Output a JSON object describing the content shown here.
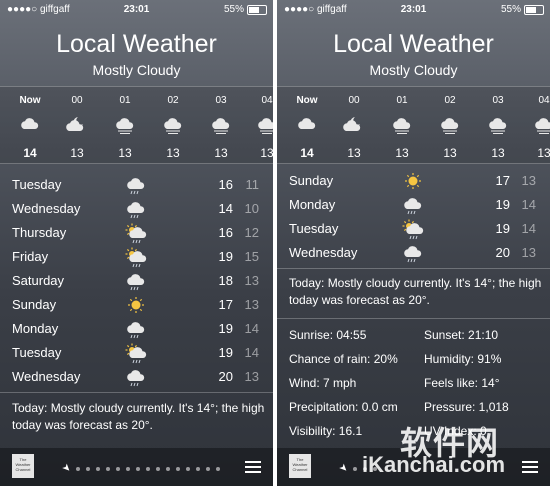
{
  "left": {
    "status": {
      "carrier": "●●●●○ giffgaff",
      "time": "23:01",
      "battery": "55%"
    },
    "title": "Local Weather",
    "subtitle": "Mostly Cloudy",
    "hourly": [
      {
        "label": "Now",
        "icon": "cloud-icon",
        "temp": "14"
      },
      {
        "label": "00",
        "icon": "partly-cloudy-night-icon",
        "temp": "13"
      },
      {
        "label": "01",
        "icon": "cloud-wind-icon",
        "temp": "13"
      },
      {
        "label": "02",
        "icon": "cloud-wind-icon",
        "temp": "13"
      },
      {
        "label": "03",
        "icon": "cloud-wind-icon",
        "temp": "13"
      },
      {
        "label": "04",
        "icon": "cloud-wind-icon",
        "temp": "13"
      }
    ],
    "daily": [
      {
        "day": "Tuesday",
        "icon": "cloud-rain-icon",
        "hi": "16",
        "lo": "11"
      },
      {
        "day": "Wednesday",
        "icon": "cloud-rain-icon",
        "hi": "14",
        "lo": "10"
      },
      {
        "day": "Thursday",
        "icon": "sun-cloud-rain-icon",
        "hi": "16",
        "lo": "12"
      },
      {
        "day": "Friday",
        "icon": "sun-cloud-rain-icon",
        "hi": "19",
        "lo": "15"
      },
      {
        "day": "Saturday",
        "icon": "cloud-rain-icon",
        "hi": "18",
        "lo": "13"
      },
      {
        "day": "Sunday",
        "icon": "sun-icon",
        "hi": "17",
        "lo": "13"
      },
      {
        "day": "Monday",
        "icon": "cloud-rain-icon",
        "hi": "19",
        "lo": "14"
      },
      {
        "day": "Tuesday",
        "icon": "sun-cloud-rain-icon",
        "hi": "19",
        "lo": "14"
      },
      {
        "day": "Wednesday",
        "icon": "cloud-rain-icon",
        "hi": "20",
        "lo": "13"
      }
    ],
    "summary": "Today: Mostly cloudy currently. It's 14°; the high today was forecast as 20°.",
    "logo_text": "The Weather Channel"
  },
  "right": {
    "status": {
      "carrier": "●●●●○ giffgaff",
      "time": "23:01",
      "battery": "55%"
    },
    "title": "Local Weather",
    "subtitle": "Mostly Cloudy",
    "hourly": [
      {
        "label": "Now",
        "icon": "cloud-icon",
        "temp": "14"
      },
      {
        "label": "00",
        "icon": "partly-cloudy-night-icon",
        "temp": "13"
      },
      {
        "label": "01",
        "icon": "cloud-wind-icon",
        "temp": "13"
      },
      {
        "label": "02",
        "icon": "cloud-wind-icon",
        "temp": "13"
      },
      {
        "label": "03",
        "icon": "cloud-wind-icon",
        "temp": "13"
      },
      {
        "label": "04",
        "icon": "cloud-wind-icon",
        "temp": "13"
      }
    ],
    "daily": [
      {
        "day": "Sunday",
        "icon": "sun-icon",
        "hi": "17",
        "lo": "13"
      },
      {
        "day": "Monday",
        "icon": "cloud-rain-icon",
        "hi": "19",
        "lo": "14"
      },
      {
        "day": "Tuesday",
        "icon": "sun-cloud-rain-icon",
        "hi": "19",
        "lo": "14"
      },
      {
        "day": "Wednesday",
        "icon": "cloud-rain-icon",
        "hi": "20",
        "lo": "13"
      }
    ],
    "summary": "Today: Mostly cloudy currently. It's 14°; the high today was forecast as 20°.",
    "details": [
      {
        "left": "Sunrise: 04:55",
        "right": "Sunset: 21:10"
      },
      {
        "left": "Chance of rain: 20%",
        "right": "Humidity: 91%"
      },
      {
        "left": "Wind: 7 mph",
        "right": "Feels like: 14°"
      },
      {
        "left": "Precipitation: 0.0 cm",
        "right": "Pressure: 1,018"
      },
      {
        "left": "Visibility: 16.1",
        "right": "UV Index: 0"
      }
    ],
    "logo_text": "The Weather Channel"
  },
  "watermark": {
    "main": "软件网",
    "sub": "iKanchai.com"
  },
  "colors": {
    "sun": "#f5c542",
    "text": "#ffffff"
  }
}
